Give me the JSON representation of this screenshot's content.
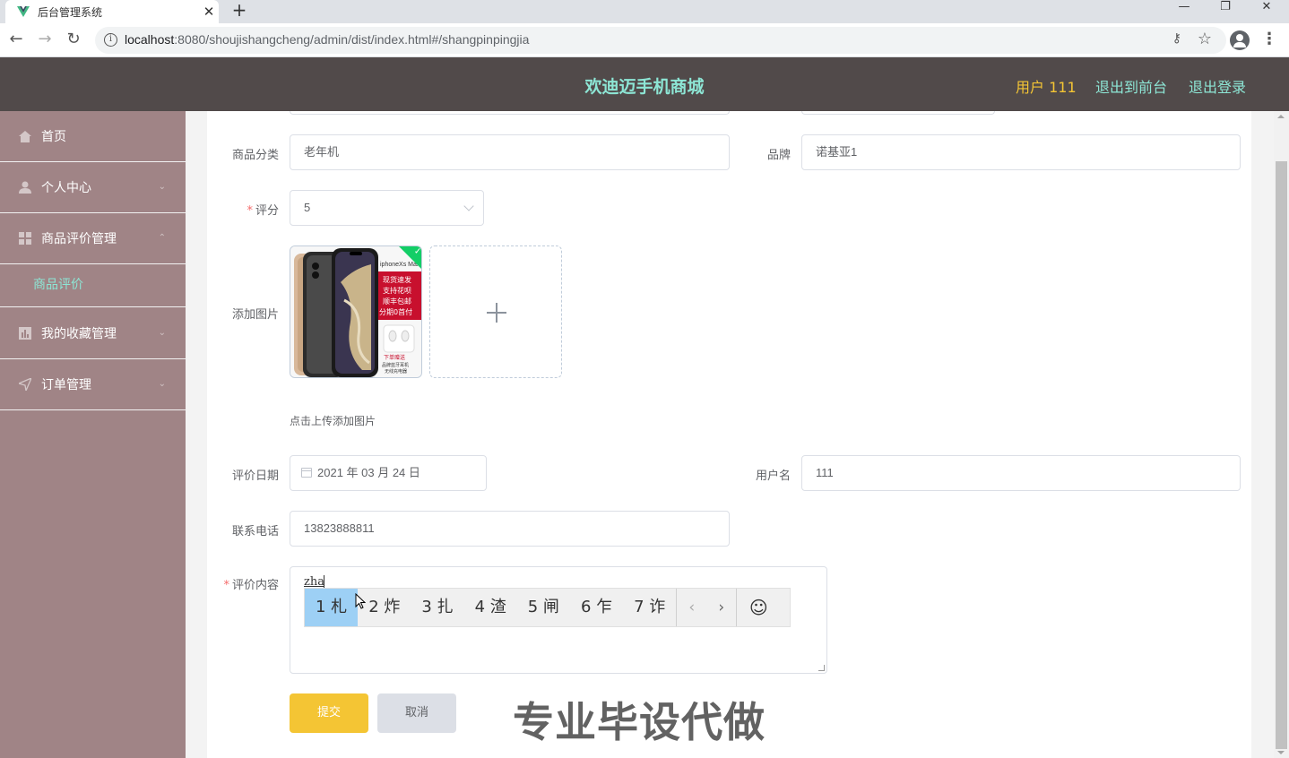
{
  "browser": {
    "tab_title": "后台管理系统",
    "tab_close": "✕",
    "new_tab": "+",
    "window_controls": {
      "minimize": "—",
      "restore": "❐",
      "close": "✕"
    },
    "nav": {
      "back": "←",
      "forward": "→",
      "reload": "↻"
    },
    "url_host": "localhost",
    "url_path": ":8080/shoujishangcheng/admin/dist/index.html#/shangpinpingjia",
    "info_glyph": "i",
    "key_glyph": "⚷",
    "star_glyph": "☆",
    "menu_glyph": "⋮"
  },
  "header": {
    "title": "欢迪迈手机商城",
    "user": "用户 111",
    "link_front": "退出到前台",
    "link_logout": "退出登录"
  },
  "sidebar": {
    "items": [
      {
        "label": "首页",
        "icon": "home-icon"
      },
      {
        "label": "个人中心",
        "icon": "user-icon"
      },
      {
        "label": "商品评价管理",
        "icon": "grid-icon"
      },
      {
        "label": "我的收藏管理",
        "icon": "chart-icon"
      },
      {
        "label": "订单管理",
        "icon": "send-icon"
      }
    ],
    "active_sub": "商品评价"
  },
  "form": {
    "category_label": "商品分类",
    "category_value": "老年机",
    "brand_label": "品牌",
    "brand_value": "诺基亚1",
    "rating_label": "评分",
    "rating_value": "5",
    "image_label": "添加图片",
    "image_thumb": {
      "model": "iphoneXs Max",
      "lines": [
        "现货速发",
        "支持花呗",
        "顺丰包邮",
        "分期0首付"
      ],
      "promo": "下单赠送",
      "promo_sub": "品牌蓝牙耳机",
      "promo_sub2": "无线充电器"
    },
    "upload_tip": "点击上传添加图片",
    "date_label": "评价日期",
    "date_value": "2021 年 03 月 24 日",
    "username_label": "用户名",
    "username_value": "111",
    "phone_label": "联系电话",
    "phone_value": "13823888811",
    "content_label": "评价内容",
    "content_typed": "zha",
    "required_mark": "*",
    "submit": "提交",
    "cancel": "取消"
  },
  "ime": {
    "candidates": [
      "1 札",
      "2 炸",
      "3 扎",
      "4 渣",
      "5 闸",
      "6 乍",
      "7 诈"
    ],
    "prev": "‹",
    "next": "›",
    "emoji": "☺"
  },
  "watermark": "专业毕设代做",
  "colors": {
    "header_bg": "#514a4a",
    "accent_teal": "#8de6d5",
    "accent_yellow": "#f4c534",
    "sidebar_bg": "#a08486"
  }
}
